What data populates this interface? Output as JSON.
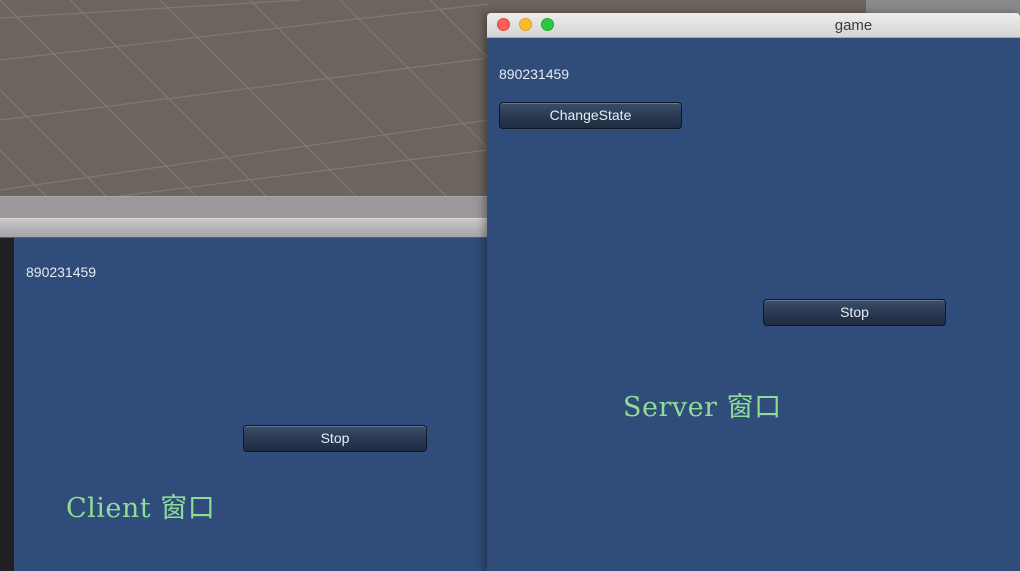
{
  "client_window": {
    "seed_text": "890231459",
    "stop_label": "Stop",
    "caption": "Client 窗口"
  },
  "server_window": {
    "title": "game",
    "seed_text": "890231459",
    "change_state_label": "ChangeState",
    "stop_label": "Stop",
    "caption": "Server 窗口"
  },
  "colors": {
    "game_background": "#2f4c7a",
    "caption_text": "#8fdc96",
    "scene_floor": "#6d645d"
  }
}
